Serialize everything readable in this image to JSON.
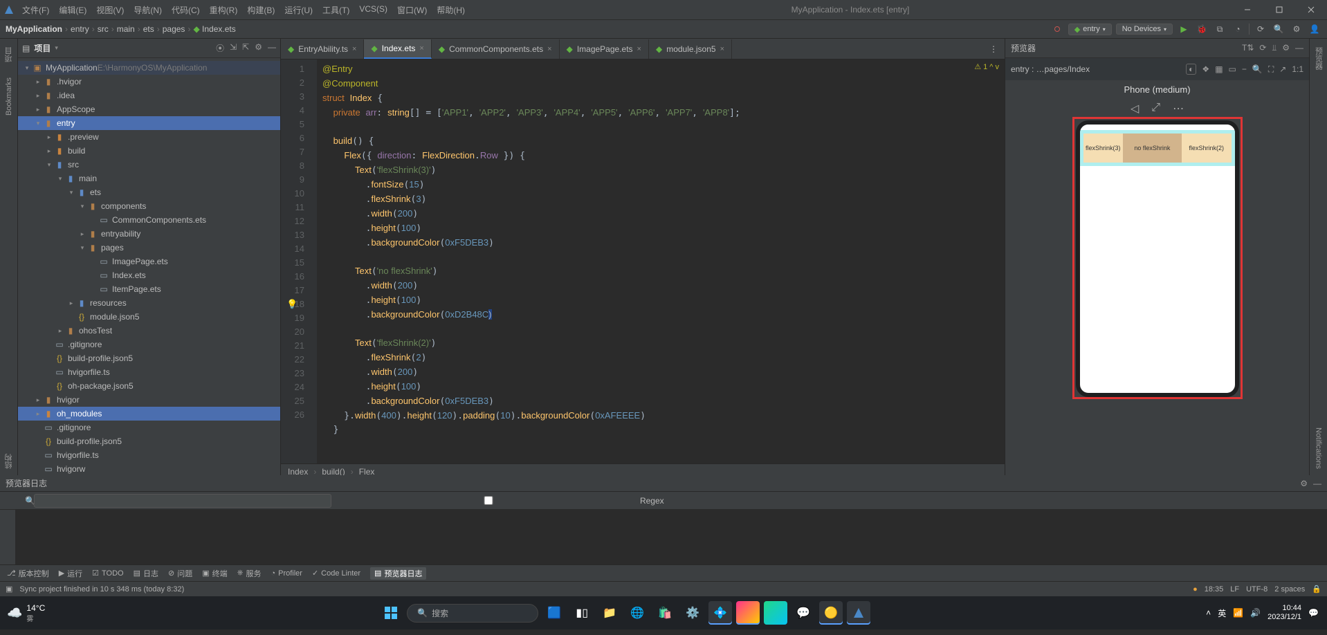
{
  "window": {
    "title": "MyApplication - Index.ets [entry]"
  },
  "menus": [
    "文件(F)",
    "编辑(E)",
    "视图(V)",
    "导航(N)",
    "代码(C)",
    "重构(R)",
    "构建(B)",
    "运行(U)",
    "工具(T)",
    "VCS(S)",
    "窗口(W)",
    "帮助(H)"
  ],
  "breadcrumbs": [
    "MyApplication",
    "entry",
    "src",
    "main",
    "ets",
    "pages",
    "Index.ets"
  ],
  "navRight": {
    "config": "entry",
    "device": "No Devices"
  },
  "project": {
    "title": "项目",
    "tree": [
      {
        "d": 0,
        "exp": true,
        "icon": "folder-root",
        "label": "MyApplication",
        "suffix": "E:\\HarmonyOS\\MyApplication",
        "sel": true
      },
      {
        "d": 1,
        "exp": false,
        "icon": "folder",
        "label": ".hvigor"
      },
      {
        "d": 1,
        "exp": false,
        "icon": "folder",
        "label": ".idea"
      },
      {
        "d": 1,
        "exp": false,
        "icon": "folder",
        "label": "AppScope"
      },
      {
        "d": 1,
        "exp": true,
        "icon": "folder-mod",
        "label": "entry",
        "hi": true
      },
      {
        "d": 2,
        "exp": false,
        "icon": "folder-gen",
        "label": ".preview"
      },
      {
        "d": 2,
        "exp": false,
        "icon": "folder-gen",
        "label": "build"
      },
      {
        "d": 2,
        "exp": true,
        "icon": "folder-blue",
        "label": "src"
      },
      {
        "d": 3,
        "exp": true,
        "icon": "folder-blue",
        "label": "main"
      },
      {
        "d": 4,
        "exp": true,
        "icon": "folder-blue",
        "label": "ets"
      },
      {
        "d": 5,
        "exp": true,
        "icon": "folder",
        "label": "components"
      },
      {
        "d": 6,
        "exp": null,
        "icon": "file",
        "label": "CommonComponents.ets"
      },
      {
        "d": 5,
        "exp": false,
        "icon": "folder",
        "label": "entryability"
      },
      {
        "d": 5,
        "exp": true,
        "icon": "folder",
        "label": "pages"
      },
      {
        "d": 6,
        "exp": null,
        "icon": "file",
        "label": "ImagePage.ets"
      },
      {
        "d": 6,
        "exp": null,
        "icon": "file",
        "label": "Index.ets"
      },
      {
        "d": 6,
        "exp": null,
        "icon": "file",
        "label": "ItemPage.ets"
      },
      {
        "d": 4,
        "exp": false,
        "icon": "folder-blue",
        "label": "resources"
      },
      {
        "d": 4,
        "exp": null,
        "icon": "json",
        "label": "module.json5"
      },
      {
        "d": 3,
        "exp": false,
        "icon": "folder",
        "label": "ohosTest"
      },
      {
        "d": 2,
        "exp": null,
        "icon": "file",
        "label": ".gitignore"
      },
      {
        "d": 2,
        "exp": null,
        "icon": "json",
        "label": "build-profile.json5"
      },
      {
        "d": 2,
        "exp": null,
        "icon": "file",
        "label": "hvigorfile.ts"
      },
      {
        "d": 2,
        "exp": null,
        "icon": "json",
        "label": "oh-package.json5"
      },
      {
        "d": 1,
        "exp": false,
        "icon": "folder",
        "label": "hvigor"
      },
      {
        "d": 1,
        "exp": false,
        "icon": "folder-gen",
        "label": "oh_modules",
        "hi": true
      },
      {
        "d": 1,
        "exp": null,
        "icon": "file",
        "label": ".gitignore"
      },
      {
        "d": 1,
        "exp": null,
        "icon": "json",
        "label": "build-profile.json5"
      },
      {
        "d": 1,
        "exp": null,
        "icon": "file",
        "label": "hvigorfile.ts"
      },
      {
        "d": 1,
        "exp": null,
        "icon": "file",
        "label": "hvigorw"
      }
    ]
  },
  "tabs": [
    {
      "label": "EntryAbility.ts",
      "icon": "ts"
    },
    {
      "label": "Index.ets",
      "icon": "ets",
      "active": true
    },
    {
      "label": "CommonComponents.ets",
      "icon": "ets"
    },
    {
      "label": "ImagePage.ets",
      "icon": "ets"
    },
    {
      "label": "module.json5",
      "icon": "json"
    }
  ],
  "editorInfo": "⚠ 1   ^ v",
  "code": {
    "lines": [
      {
        "n": 1,
        "html": "<span class='ann'>@Entry</span>"
      },
      {
        "n": 2,
        "html": "<span class='ann'>@Component</span>"
      },
      {
        "n": 3,
        "html": "<span class='kw'>struct</span> <span class='typ'>Index</span> {"
      },
      {
        "n": 4,
        "html": "  <span class='kw'>private</span> <span class='prop'>arr</span>: <span class='typ'>string</span>[] = [<span class='str'>'APP1'</span>, <span class='str'>'APP2'</span>, <span class='str'>'APP3'</span>, <span class='str'>'APP4'</span>, <span class='str'>'APP5'</span>, <span class='str'>'APP6'</span>, <span class='str'>'APP7'</span>, <span class='str'>'APP8'</span>];"
      },
      {
        "n": 5,
        "html": ""
      },
      {
        "n": 6,
        "html": "  <span class='meth'>build</span>() {"
      },
      {
        "n": 7,
        "html": "    <span class='typ'>Flex</span>({ <span class='prop'>direction</span>: <span class='typ'>FlexDirection</span>.<span class='prop'>Row</span> }) {"
      },
      {
        "n": 8,
        "html": "      <span class='typ'>Text</span>(<span class='str'>'flexShrink(3)'</span>)"
      },
      {
        "n": 9,
        "html": "        .<span class='meth'>fontSize</span>(<span class='num'>15</span>)"
      },
      {
        "n": 10,
        "html": "        .<span class='meth'>flexShrink</span>(<span class='num'>3</span>)"
      },
      {
        "n": 11,
        "html": "        .<span class='meth'>width</span>(<span class='num'>200</span>)"
      },
      {
        "n": 12,
        "html": "        .<span class='meth'>height</span>(<span class='num'>100</span>)"
      },
      {
        "n": 13,
        "html": "        .<span class='meth'>backgroundColor</span>(<span class='num'>0xF5DEB3</span>)"
      },
      {
        "n": 14,
        "html": ""
      },
      {
        "n": 15,
        "html": "      <span class='typ'>Text</span>(<span class='str'>'no flexShrink'</span>)"
      },
      {
        "n": 16,
        "html": "        .<span class='meth'>width</span>(<span class='num'>200</span>)"
      },
      {
        "n": 17,
        "html": "        .<span class='meth'>height</span>(<span class='num'>100</span>)"
      },
      {
        "n": 18,
        "html": "        .<span class='meth'>backgroundColor</span>(<span class='num'>0xD2B48C</span><span style='background:#214283;'>)</span>"
      },
      {
        "n": 19,
        "html": ""
      },
      {
        "n": 20,
        "html": "      <span class='typ'>Text</span>(<span class='str'>'flexShrink(2)'</span>)"
      },
      {
        "n": 21,
        "html": "        .<span class='meth'>flexShrink</span>(<span class='num'>2</span>)"
      },
      {
        "n": 22,
        "html": "        .<span class='meth'>width</span>(<span class='num'>200</span>)"
      },
      {
        "n": 23,
        "html": "        .<span class='meth'>height</span>(<span class='num'>100</span>)"
      },
      {
        "n": 24,
        "html": "        .<span class='meth'>backgroundColor</span>(<span class='num'>0xF5DEB3</span>)"
      },
      {
        "n": 25,
        "html": "    }.<span class='meth'>width</span>(<span class='num'>400</span>).<span class='meth'>height</span>(<span class='num'>120</span>).<span class='meth'>padding</span>(<span class='num'>10</span>).<span class='meth'>backgroundColor</span>(<span class='num'>0xAFEEEE</span>)"
      },
      {
        "n": 26,
        "html": "  }"
      }
    ]
  },
  "editorBreadcrumb": [
    "Index",
    "build()",
    "Flex"
  ],
  "preview": {
    "title": "预览器",
    "path": "entry : …pages/Index",
    "device": "Phone (medium)",
    "cells": [
      "flexShrink(3)",
      "no flexShrink",
      "flexShrink(2)"
    ],
    "zoom": "1:1"
  },
  "log": {
    "title": "预览器日志",
    "searchPlaceholder": "",
    "regex": "Regex"
  },
  "bottomTools": [
    "版本控制",
    "运行",
    "TODO",
    "日志",
    "问题",
    "终端",
    "服务",
    "Profiler",
    "Code Linter",
    "预览器日志"
  ],
  "status": {
    "msg": "Sync project finished in 10 s 348 ms (today 8:32)",
    "time": "18:35",
    "eol": "LF",
    "enc": "UTF-8",
    "indent": "2 spaces"
  },
  "leftGutter": [
    "项目",
    "Bookmarks",
    "结构"
  ],
  "rightGutter": [
    "预览器",
    "Notifications"
  ],
  "taskbar": {
    "weatherTemp": "14°C",
    "weatherDesc": "雾",
    "search": "搜索",
    "clockTime": "10:44",
    "clockDate": "2023/12/1",
    "ime": "英"
  }
}
